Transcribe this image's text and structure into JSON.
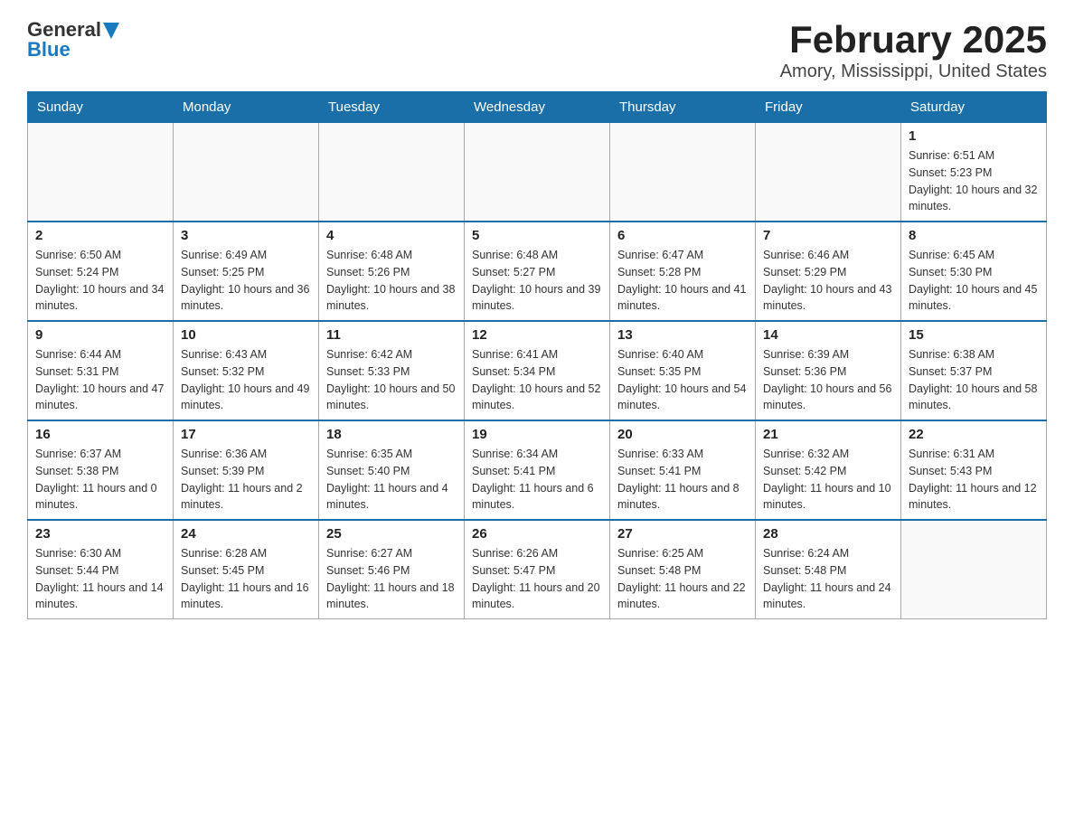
{
  "logo": {
    "general": "General",
    "blue": "Blue"
  },
  "title": "February 2025",
  "subtitle": "Amory, Mississippi, United States",
  "days_of_week": [
    "Sunday",
    "Monday",
    "Tuesday",
    "Wednesday",
    "Thursday",
    "Friday",
    "Saturday"
  ],
  "weeks": [
    [
      {
        "day": "",
        "info": ""
      },
      {
        "day": "",
        "info": ""
      },
      {
        "day": "",
        "info": ""
      },
      {
        "day": "",
        "info": ""
      },
      {
        "day": "",
        "info": ""
      },
      {
        "day": "",
        "info": ""
      },
      {
        "day": "1",
        "info": "Sunrise: 6:51 AM\nSunset: 5:23 PM\nDaylight: 10 hours and 32 minutes."
      }
    ],
    [
      {
        "day": "2",
        "info": "Sunrise: 6:50 AM\nSunset: 5:24 PM\nDaylight: 10 hours and 34 minutes."
      },
      {
        "day": "3",
        "info": "Sunrise: 6:49 AM\nSunset: 5:25 PM\nDaylight: 10 hours and 36 minutes."
      },
      {
        "day": "4",
        "info": "Sunrise: 6:48 AM\nSunset: 5:26 PM\nDaylight: 10 hours and 38 minutes."
      },
      {
        "day": "5",
        "info": "Sunrise: 6:48 AM\nSunset: 5:27 PM\nDaylight: 10 hours and 39 minutes."
      },
      {
        "day": "6",
        "info": "Sunrise: 6:47 AM\nSunset: 5:28 PM\nDaylight: 10 hours and 41 minutes."
      },
      {
        "day": "7",
        "info": "Sunrise: 6:46 AM\nSunset: 5:29 PM\nDaylight: 10 hours and 43 minutes."
      },
      {
        "day": "8",
        "info": "Sunrise: 6:45 AM\nSunset: 5:30 PM\nDaylight: 10 hours and 45 minutes."
      }
    ],
    [
      {
        "day": "9",
        "info": "Sunrise: 6:44 AM\nSunset: 5:31 PM\nDaylight: 10 hours and 47 minutes."
      },
      {
        "day": "10",
        "info": "Sunrise: 6:43 AM\nSunset: 5:32 PM\nDaylight: 10 hours and 49 minutes."
      },
      {
        "day": "11",
        "info": "Sunrise: 6:42 AM\nSunset: 5:33 PM\nDaylight: 10 hours and 50 minutes."
      },
      {
        "day": "12",
        "info": "Sunrise: 6:41 AM\nSunset: 5:34 PM\nDaylight: 10 hours and 52 minutes."
      },
      {
        "day": "13",
        "info": "Sunrise: 6:40 AM\nSunset: 5:35 PM\nDaylight: 10 hours and 54 minutes."
      },
      {
        "day": "14",
        "info": "Sunrise: 6:39 AM\nSunset: 5:36 PM\nDaylight: 10 hours and 56 minutes."
      },
      {
        "day": "15",
        "info": "Sunrise: 6:38 AM\nSunset: 5:37 PM\nDaylight: 10 hours and 58 minutes."
      }
    ],
    [
      {
        "day": "16",
        "info": "Sunrise: 6:37 AM\nSunset: 5:38 PM\nDaylight: 11 hours and 0 minutes."
      },
      {
        "day": "17",
        "info": "Sunrise: 6:36 AM\nSunset: 5:39 PM\nDaylight: 11 hours and 2 minutes."
      },
      {
        "day": "18",
        "info": "Sunrise: 6:35 AM\nSunset: 5:40 PM\nDaylight: 11 hours and 4 minutes."
      },
      {
        "day": "19",
        "info": "Sunrise: 6:34 AM\nSunset: 5:41 PM\nDaylight: 11 hours and 6 minutes."
      },
      {
        "day": "20",
        "info": "Sunrise: 6:33 AM\nSunset: 5:41 PM\nDaylight: 11 hours and 8 minutes."
      },
      {
        "day": "21",
        "info": "Sunrise: 6:32 AM\nSunset: 5:42 PM\nDaylight: 11 hours and 10 minutes."
      },
      {
        "day": "22",
        "info": "Sunrise: 6:31 AM\nSunset: 5:43 PM\nDaylight: 11 hours and 12 minutes."
      }
    ],
    [
      {
        "day": "23",
        "info": "Sunrise: 6:30 AM\nSunset: 5:44 PM\nDaylight: 11 hours and 14 minutes."
      },
      {
        "day": "24",
        "info": "Sunrise: 6:28 AM\nSunset: 5:45 PM\nDaylight: 11 hours and 16 minutes."
      },
      {
        "day": "25",
        "info": "Sunrise: 6:27 AM\nSunset: 5:46 PM\nDaylight: 11 hours and 18 minutes."
      },
      {
        "day": "26",
        "info": "Sunrise: 6:26 AM\nSunset: 5:47 PM\nDaylight: 11 hours and 20 minutes."
      },
      {
        "day": "27",
        "info": "Sunrise: 6:25 AM\nSunset: 5:48 PM\nDaylight: 11 hours and 22 minutes."
      },
      {
        "day": "28",
        "info": "Sunrise: 6:24 AM\nSunset: 5:48 PM\nDaylight: 11 hours and 24 minutes."
      },
      {
        "day": "",
        "info": ""
      }
    ]
  ]
}
